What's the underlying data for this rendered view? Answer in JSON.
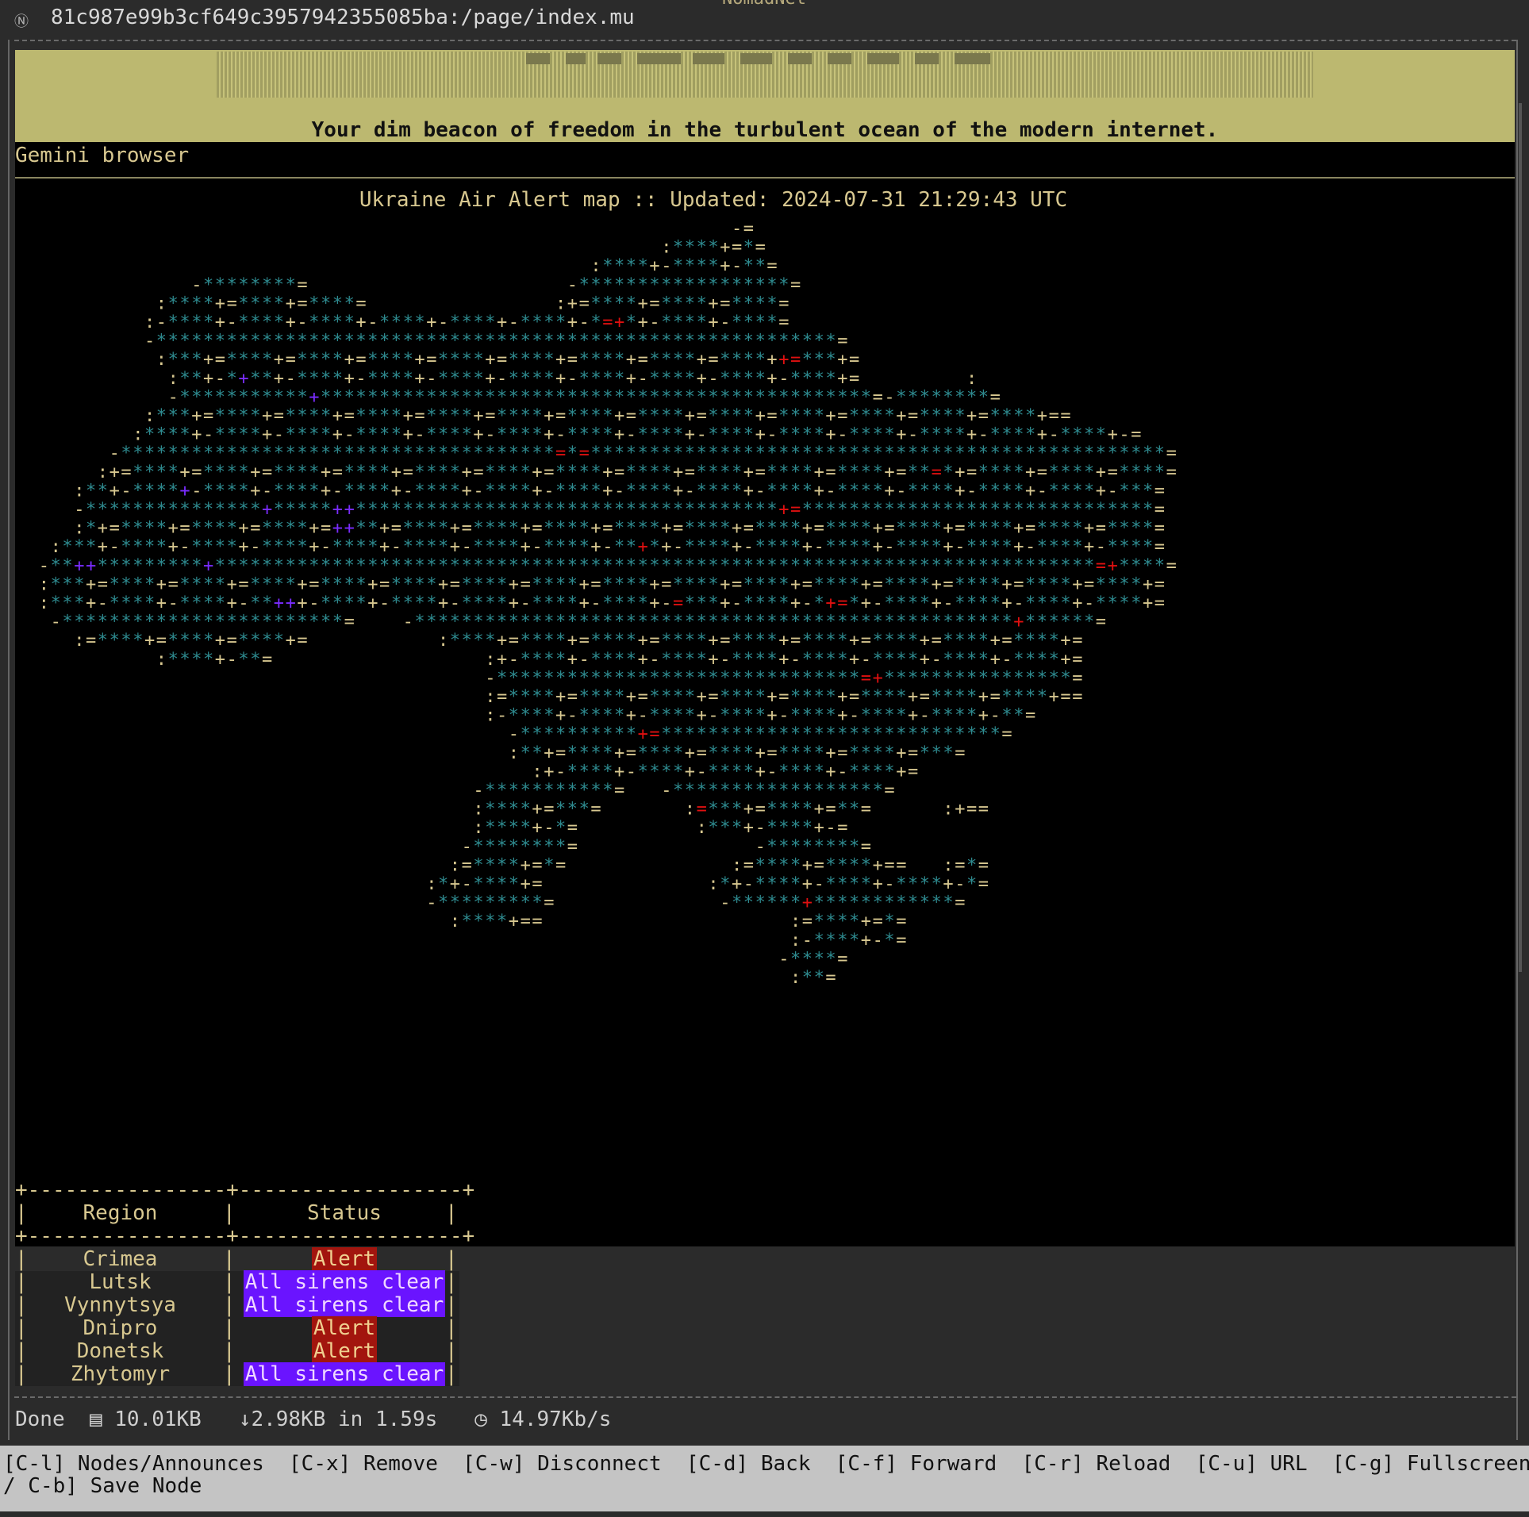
{
  "window": {
    "title_fragment": "NomadNet",
    "url": "81c987e99b3cf649c3957942355085ba:/page/index.mu"
  },
  "banner": {
    "tagline": "Your dim beacon of freedom in the turbulent ocean of the modern internet."
  },
  "page": {
    "browser_label": "Gemini browser",
    "map_title": "Ukraine Air Alert map :: Updated: 2024-07-31 21:29:43 UTC"
  },
  "table": {
    "border": "+----------------+------------------+",
    "header": {
      "region": "Region",
      "status": "Status"
    },
    "rows": [
      {
        "region": "Crimea",
        "status": "Alert",
        "kind": "alert"
      },
      {
        "region": "Lutsk",
        "status": "All sirens clear",
        "kind": "clear"
      },
      {
        "region": "Vynnytsya",
        "status": "All sirens clear",
        "kind": "clear"
      },
      {
        "region": "Dnipro",
        "status": "Alert",
        "kind": "alert"
      },
      {
        "region": "Donetsk",
        "status": "Alert",
        "kind": "alert"
      },
      {
        "region": "Zhytomyr",
        "status": "All sirens clear",
        "kind": "clear"
      }
    ]
  },
  "status_bar": {
    "state": "Done",
    "size": "10.01KB",
    "downloaded": "↓2.98KB in 1.59s",
    "speed": "14.97Kb/s"
  },
  "keys": {
    "line1": "[C-l] Nodes/Announces  [C-x] Remove  [C-w] Disconnect  [C-d] Back  [C-f] Forward  [C-r] Reload  [C-u] URL  [C-g] Fullscreen  [C-",
    "line2": "/ C-b] Save Node"
  },
  "colors": {
    "text": "#d8c890",
    "map_star": "#2e8a8f",
    "alert": "#e01010",
    "clear": "#7a2cff",
    "banner_bg": "#bcb870",
    "content_bg": "#000000"
  }
}
